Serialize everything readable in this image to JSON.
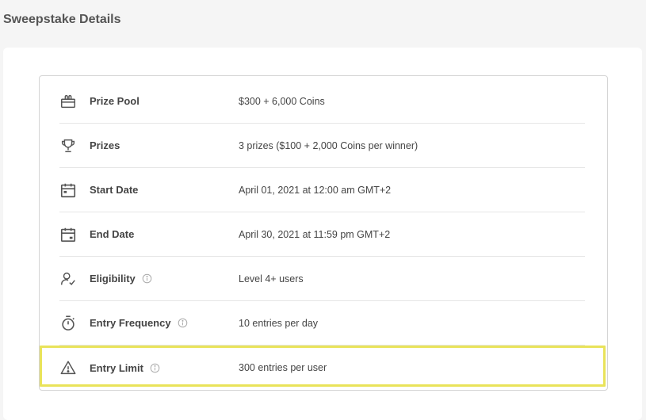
{
  "page": {
    "title": "Sweepstake Details"
  },
  "details": [
    {
      "icon": "gift-icon",
      "label": "Prize Pool",
      "value": "$300 + 6,000 Coins",
      "info": false
    },
    {
      "icon": "trophy-icon",
      "label": "Prizes",
      "value": "3 prizes ($100 + 2,000 Coins per winner)",
      "info": false
    },
    {
      "icon": "calendar-start-icon",
      "label": "Start Date",
      "value": "April 01, 2021 at 12:00 am GMT+2",
      "info": false
    },
    {
      "icon": "calendar-end-icon",
      "label": "End Date",
      "value": "April 30, 2021 at 11:59 pm GMT+2",
      "info": false
    },
    {
      "icon": "user-check-icon",
      "label": "Eligibility",
      "value": "Level 4+ users",
      "info": true
    },
    {
      "icon": "stopwatch-icon",
      "label": "Entry Frequency",
      "value": "10 entries per day",
      "info": true
    },
    {
      "icon": "warning-icon",
      "label": "Entry Limit",
      "value": "300 entries per user",
      "info": true
    }
  ],
  "colors": {
    "highlight": "#e9e35a",
    "icon": "#555555"
  }
}
